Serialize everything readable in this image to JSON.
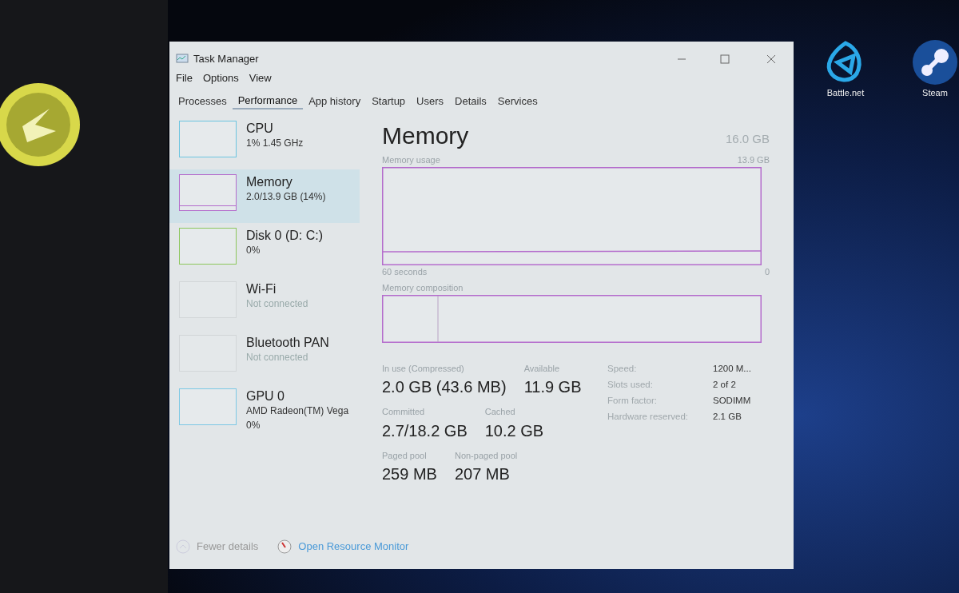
{
  "window": {
    "title": "Task Manager"
  },
  "menu": [
    "File",
    "Options",
    "View"
  ],
  "tabs": [
    {
      "label": "Processes",
      "selected": false
    },
    {
      "label": "Performance",
      "selected": true
    },
    {
      "label": "App history",
      "selected": false
    },
    {
      "label": "Startup",
      "selected": false
    },
    {
      "label": "Users",
      "selected": false
    },
    {
      "label": "Details",
      "selected": false
    },
    {
      "label": "Services",
      "selected": false
    }
  ],
  "sidebar": {
    "items": [
      {
        "name": "CPU",
        "details": [
          "1% 1.45 GHz"
        ],
        "color": "#6cc4e0",
        "selected": false,
        "disabled": false
      },
      {
        "name": "Memory",
        "details": [
          "2.0/13.9 GB (14%)"
        ],
        "color": "#b46ccc",
        "selected": true,
        "disabled": false
      },
      {
        "name": "Disk 0 (D: C:)",
        "details": [
          "0%"
        ],
        "color": "#8cc65c",
        "selected": false,
        "disabled": false
      },
      {
        "name": "Wi-Fi",
        "details": [
          "Not connected"
        ],
        "color": "#d2d6d8",
        "selected": false,
        "disabled": true
      },
      {
        "name": "Bluetooth PAN",
        "details": [
          "Not connected"
        ],
        "color": "#d2d6d8",
        "selected": false,
        "disabled": true
      },
      {
        "name": "GPU 0",
        "details": [
          "AMD Radeon(TM) Vega",
          "0%"
        ],
        "color": "#7cc8e4",
        "selected": false,
        "disabled": false
      }
    ]
  },
  "detail": {
    "title": "Memory",
    "total": "16.0 GB",
    "usage_label": "Memory usage",
    "usage_max": "13.9 GB",
    "time_label": "60 seconds",
    "time_end": "0",
    "composition_label": "Memory composition",
    "stats": [
      [
        {
          "label": "In use (Compressed)",
          "value": "2.0 GB (43.6 MB)"
        },
        {
          "label": "Available",
          "value": "11.9 GB"
        }
      ],
      [
        {
          "label": "Committed",
          "value": "2.7/18.2 GB"
        },
        {
          "label": "Cached",
          "value": "10.2 GB"
        }
      ],
      [
        {
          "label": "Paged pool",
          "value": "259 MB"
        },
        {
          "label": "Non-paged pool",
          "value": "207 MB"
        }
      ]
    ],
    "specs": [
      {
        "label": "Speed:",
        "value": "1200 M..."
      },
      {
        "label": "Slots used:",
        "value": "2 of 2"
      },
      {
        "label": "Form factor:",
        "value": "SODIMM"
      },
      {
        "label": "Hardware reserved:",
        "value": "2.1 GB"
      }
    ]
  },
  "footer": {
    "fewer_details": "Fewer details",
    "resource_monitor": "Open Resource Monitor"
  },
  "desktop_icons": [
    {
      "label": "Battle.net",
      "kind": "battlenet"
    },
    {
      "label": "Steam",
      "kind": "steam"
    }
  ]
}
